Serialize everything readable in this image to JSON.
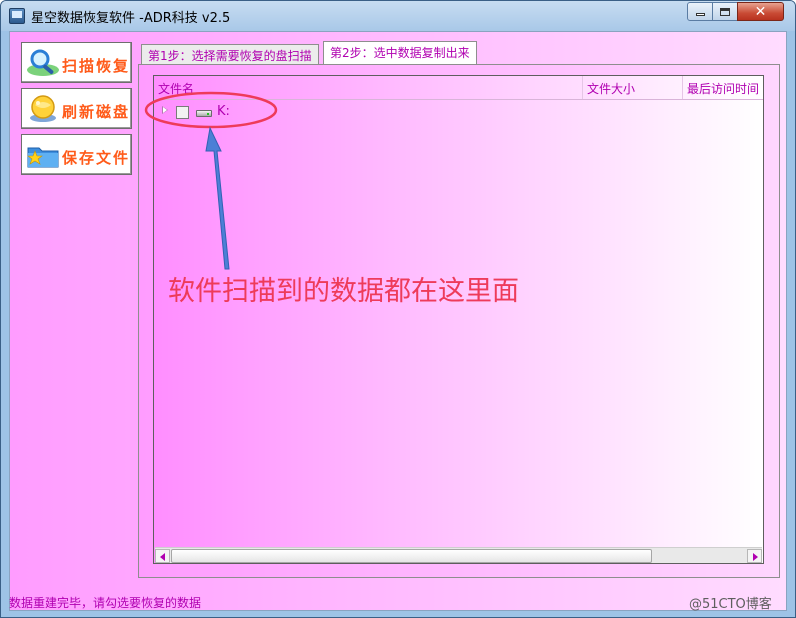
{
  "window": {
    "title": "星空数据恢复软件   -ADR科技 v2.5"
  },
  "sidebar": {
    "buttons": [
      {
        "label": "扫描恢复",
        "icon": "magnifier-icon"
      },
      {
        "label": "刷新磁盘",
        "icon": "disk-globe-icon"
      },
      {
        "label": "保存文件",
        "icon": "save-folder-icon"
      }
    ]
  },
  "tabs": [
    {
      "label": "第1步：选择需要恢复的盘扫描",
      "active": false
    },
    {
      "label": "第2步：选中数据复制出来",
      "active": true
    }
  ],
  "file_tree": {
    "columns": [
      "文件名",
      "文件大小",
      "最后访问时间"
    ],
    "rows": [
      {
        "label": "K:",
        "checked": false,
        "expanded": false,
        "icon": "drive-icon"
      }
    ]
  },
  "annotation": {
    "text": "软件扫描到的数据都在这里面",
    "color": "#ee3b5a",
    "arrow_color": "#4c7fd6"
  },
  "status_bar": {
    "text": "数据重建完毕，请勾选要恢复的数据"
  },
  "watermark": "@51CTO博客",
  "colors": {
    "accent_text": "#b000b0",
    "button_label": "#ff5b1a",
    "background_pink": "#ffaaff"
  }
}
